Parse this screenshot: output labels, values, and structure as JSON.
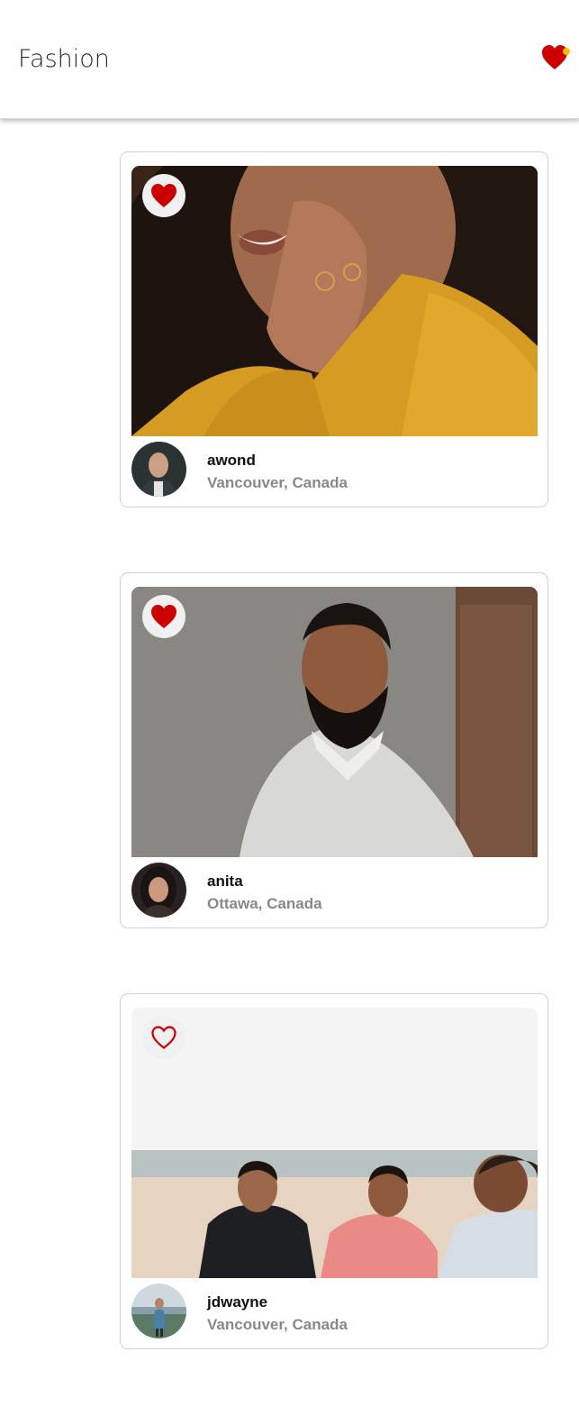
{
  "app": {
    "title": "Fashion"
  },
  "header": {
    "favorites_icon": "heart-icon",
    "favorites_color": "#cc0000",
    "badge_color": "#f5c000"
  },
  "posts": [
    {
      "username": "awond",
      "location": "Vancouver, Canada",
      "liked": true
    },
    {
      "username": "anita",
      "location": "Ottawa, Canada",
      "liked": true
    },
    {
      "username": "jdwayne",
      "location": "Vancouver, Canada",
      "liked": false
    }
  ],
  "colors": {
    "like": "#cc0000",
    "muted_text": "#888888"
  }
}
